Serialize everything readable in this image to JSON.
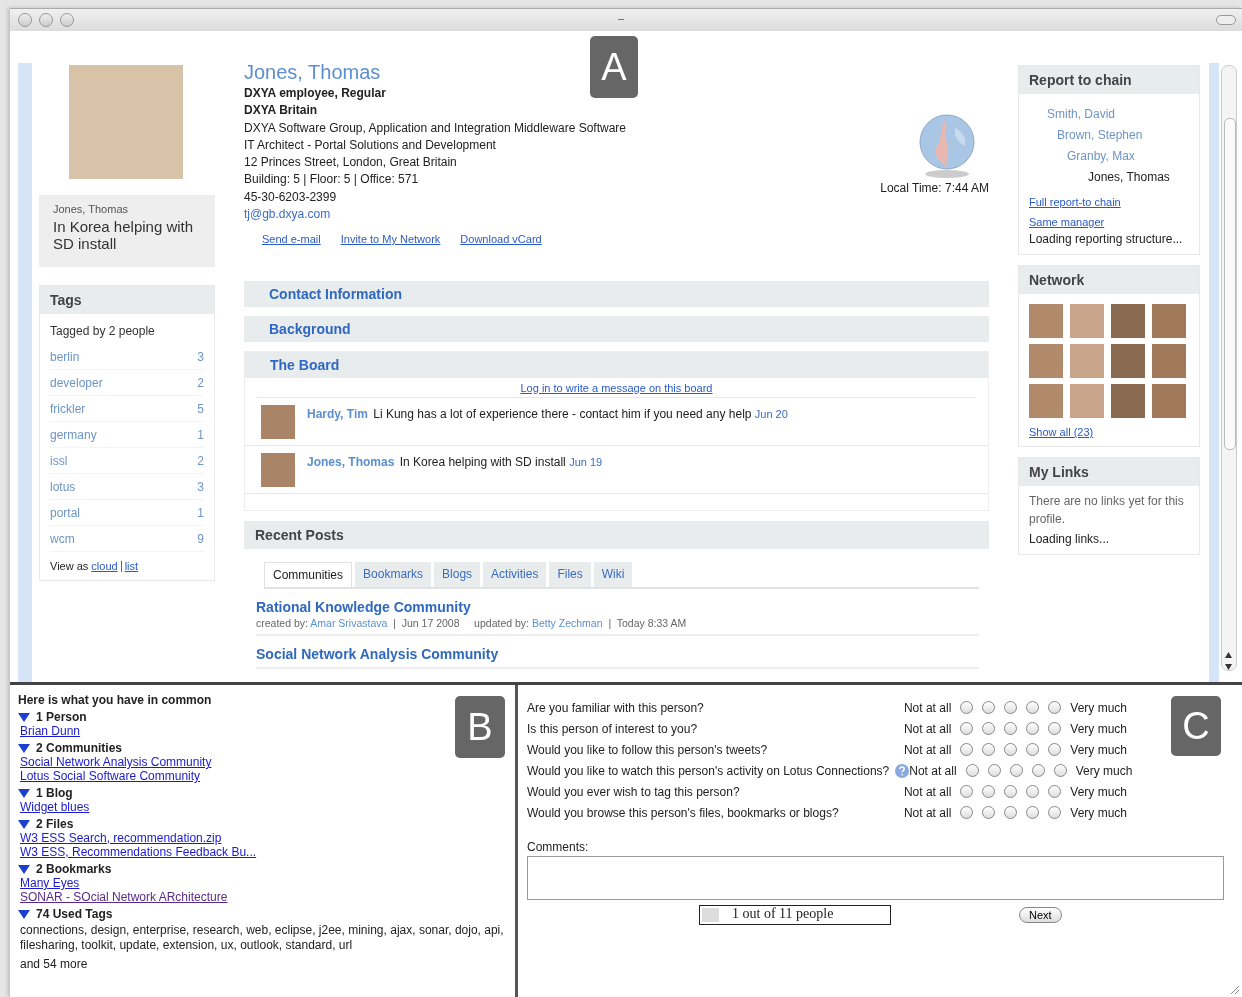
{
  "window": {
    "title": "–"
  },
  "callouts": [
    {
      "label": "A"
    },
    {
      "label": "B"
    },
    {
      "label": "C"
    }
  ],
  "profile": {
    "status_card": {
      "name": "Jones, Thomas",
      "status": "In Korea helping with SD install"
    },
    "name": "Jones, Thomas",
    "bold_lines": [
      "DXYA employee, Regular",
      "DXYA Britain"
    ],
    "lines": [
      "DXYA Software Group, Application and Integration Middleware Software",
      "IT Architect - Portal Solutions and Development",
      "12 Princes Street, London, Great Britain",
      "Building: 5  | Floor: 5  | Office: 571",
      "45-30-6203-2399"
    ],
    "email": "tj@gb.dxya.com",
    "actions": [
      "Send e-mail ",
      "Invite to My Network ",
      "Download vCard"
    ],
    "local_time": "Local Time: 7:44 AM"
  },
  "tags": {
    "title": "Tags",
    "tagged_by": "Tagged by 2 people",
    "items": [
      {
        "name": "berlin",
        "count": "3"
      },
      {
        "name": "developer",
        "count": "2"
      },
      {
        "name": "frickler",
        "count": "5"
      },
      {
        "name": "germany",
        "count": "1"
      },
      {
        "name": "issl",
        "count": "2"
      },
      {
        "name": "lotus",
        "count": "3"
      },
      {
        "name": "portal",
        "count": "1"
      },
      {
        "name": "wcm",
        "count": "9"
      }
    ],
    "view_as": "View as",
    "view_links": [
      "cloud",
      "list"
    ]
  },
  "sections": [
    {
      "title": "Contact Information"
    },
    {
      "title": "Background"
    }
  ],
  "board": {
    "title": "The Board",
    "login_link": "Log in to write a message on this board",
    "posts": [
      {
        "author": "Hardy, Tim",
        "text": "Li Kung has a lot of experience there - contact him if you need any help",
        "date": "Jun 20"
      },
      {
        "author": "Jones, Thomas",
        "text": "In Korea helping with SD install",
        "date": "Jun 19"
      }
    ]
  },
  "recent_posts": {
    "title": "Recent Posts",
    "tabs": [
      {
        "label": "Communities",
        "selected": true
      },
      {
        "label": "Bookmarks",
        "selected": false
      },
      {
        "label": "Blogs",
        "selected": false
      },
      {
        "label": "Activities",
        "selected": false
      },
      {
        "label": "Files",
        "selected": false
      },
      {
        "label": "Wiki",
        "selected": false
      }
    ],
    "entries": [
      {
        "title": "Rational Knowledge Community",
        "created_label": "created by:",
        "creator": "Amar Srivastava",
        "separator": "|",
        "created": "Jun 17 2008",
        "updated_label": "updated by:",
        "updater": "Betty Zechman",
        "updated": "Today 8:33 AM"
      },
      {
        "title": "Social Network Analysis Community"
      }
    ]
  },
  "report_chain": {
    "title": "Report to chain",
    "people": [
      {
        "name": "Smith, David",
        "current": false,
        "children": [
          {
            "name": "Brown, Stephen",
            "current": false,
            "children": [
              {
                "name": "Granby, Max",
                "current": false,
                "children": [
                  {
                    "name": "Jones, Thomas",
                    "current": true
                  }
                ]
              }
            ]
          }
        ]
      }
    ],
    "links": [
      "Full report-to chain",
      "Same manager"
    ],
    "loading": "Loading reporting structure..."
  },
  "network": {
    "title": "Network",
    "members": [
      {
        "kind": "photo"
      },
      {
        "kind": "photo"
      },
      {
        "kind": "photo"
      },
      {
        "kind": "photo"
      },
      {
        "kind": "photo"
      },
      {
        "kind": "photo"
      },
      {
        "kind": "photo"
      },
      {
        "kind": "photo"
      },
      {
        "kind": "photo"
      },
      {
        "kind": "photo"
      },
      {
        "kind": "photo"
      },
      {
        "kind": "photo"
      }
    ],
    "show_all": "Show all (23)"
  },
  "my_links": {
    "title": "My Links",
    "empty": "There are no links yet for this profile.",
    "loading": "Loading links..."
  },
  "common": {
    "title": "Here is what you have in common",
    "groups": [
      {
        "label": "1 Person",
        "expanded": true,
        "items": [
          {
            "kind": "link",
            "text": "Brian Dunn",
            "visited": false
          }
        ]
      },
      {
        "label": "2 Communities",
        "expanded": true,
        "items": [
          {
            "kind": "link",
            "text": "Social Network Analysis Community",
            "visited": false
          },
          {
            "kind": "link",
            "text": "Lotus Social Software Community",
            "visited": false
          }
        ]
      },
      {
        "label": "1 Blog",
        "expanded": true,
        "items": [
          {
            "kind": "link",
            "text": "Widget blues",
            "visited": false
          }
        ]
      },
      {
        "label": "2 Files",
        "expanded": true,
        "items": [
          {
            "kind": "link",
            "text": "W3 ESS Search, recommendation.zip",
            "visited": false
          },
          {
            "kind": "link",
            "text": "W3 ESS, Recommendations Feedback Bu...",
            "visited": false
          }
        ]
      },
      {
        "label": "2 Bookmarks",
        "expanded": true,
        "items": [
          {
            "kind": "link",
            "text": "Many Eyes",
            "visited": false
          },
          {
            "kind": "link",
            "text": "SONAR - SOcial Network ARchitecture",
            "visited": true
          }
        ]
      },
      {
        "label": "74 Used Tags",
        "expanded": true,
        "items": [
          {
            "kind": "text",
            "text": "connections, design, enterprise, research, web, eclipse, j2ee, mining, ajax, sonar, dojo, api, filesharing, toolkit, update, extension, ux, outlook, standard, url"
          },
          {
            "kind": "more",
            "text": "and 54 more"
          }
        ]
      }
    ]
  },
  "survey": {
    "questions": [
      {
        "text": "Are you familiar with this person?",
        "help": false,
        "low": "Not at all",
        "high": "Very much",
        "options": [
          {
            "selected": false
          },
          {
            "selected": false
          },
          {
            "selected": false
          },
          {
            "selected": false
          },
          {
            "selected": false
          }
        ]
      },
      {
        "text": "Is this person of interest to you?",
        "help": false,
        "low": "Not at all",
        "high": "Very much",
        "options": [
          {
            "selected": false
          },
          {
            "selected": false
          },
          {
            "selected": false
          },
          {
            "selected": false
          },
          {
            "selected": false
          }
        ]
      },
      {
        "text": "Would you like to follow this person's tweets?",
        "help": false,
        "low": "Not at all",
        "high": "Very much",
        "options": [
          {
            "selected": false
          },
          {
            "selected": false
          },
          {
            "selected": false
          },
          {
            "selected": false
          },
          {
            "selected": false
          }
        ]
      },
      {
        "text": "Would you like to watch this person's activity on Lotus Connections?",
        "help": true,
        "low": "Not at all",
        "high": "Very much",
        "options": [
          {
            "selected": false
          },
          {
            "selected": false
          },
          {
            "selected": false
          },
          {
            "selected": false
          },
          {
            "selected": false
          }
        ]
      },
      {
        "text": "Would you ever wish to tag this person?",
        "help": false,
        "low": "Not at all",
        "high": "Very much",
        "options": [
          {
            "selected": false
          },
          {
            "selected": false
          },
          {
            "selected": false
          },
          {
            "selected": false
          },
          {
            "selected": false
          }
        ]
      },
      {
        "text": "Would you browse this person's files, bookmarks or blogs?",
        "help": false,
        "low": "Not at all",
        "high": "Very much",
        "options": [
          {
            "selected": false
          },
          {
            "selected": false
          },
          {
            "selected": false
          },
          {
            "selected": false
          },
          {
            "selected": false
          }
        ]
      }
    ],
    "comments_label": "Comments:",
    "progress": {
      "text": "1 out of 11 people",
      "level": 0.09
    },
    "next": "Next"
  }
}
